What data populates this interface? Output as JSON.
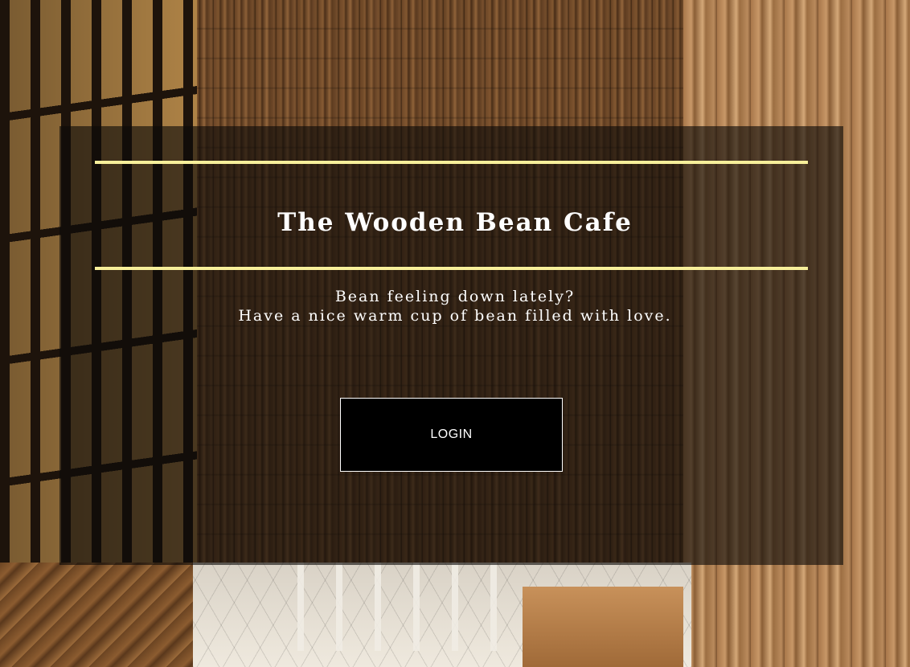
{
  "page": {
    "title": "The Wooden Bean Cafe",
    "tagline_line1": "Bean feeling down lately?",
    "tagline_line2": "Have a nice warm cup of bean filled with love."
  },
  "actions": {
    "login_label": "LOGIN"
  },
  "colors": {
    "accent_rule": "#f7ef9a",
    "overlay": "rgba(12,10,8,0.62)",
    "button_bg": "#000000",
    "text": "#ffffff"
  }
}
